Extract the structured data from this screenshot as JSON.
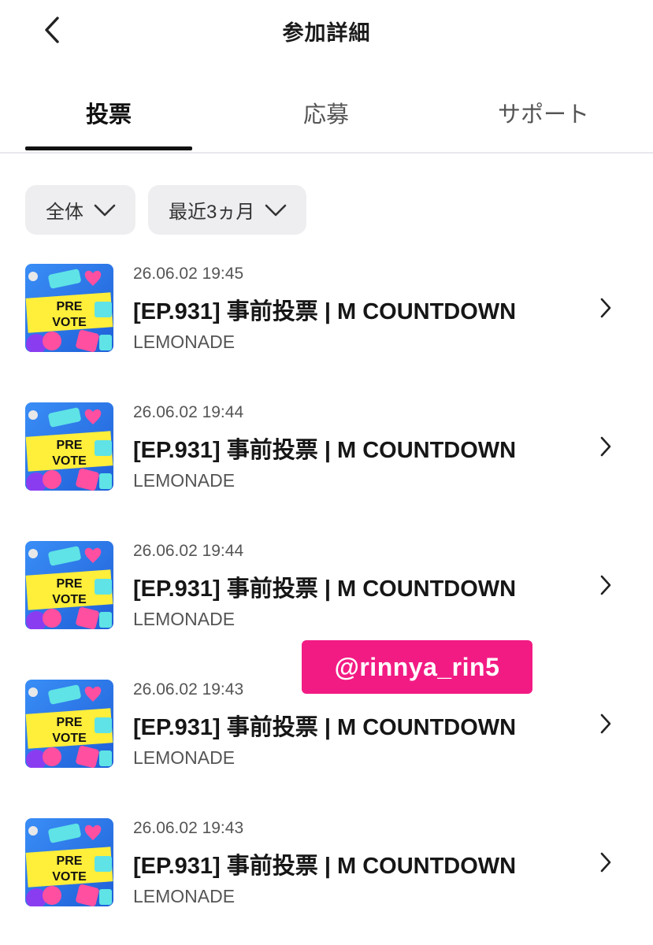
{
  "header": {
    "title": "参加詳細",
    "back_icon": "chevron-left-icon"
  },
  "tabs": [
    {
      "label": "投票",
      "active": true
    },
    {
      "label": "応募",
      "active": false
    },
    {
      "label": "サポート",
      "active": false
    }
  ],
  "filters": [
    {
      "label": "全体",
      "icon": "chevron-down-icon"
    },
    {
      "label": "最近3ヵ月",
      "icon": "chevron-down-icon"
    }
  ],
  "items": [
    {
      "date": "26.06.02 19:45",
      "title": "[EP.931] 事前投票 | M COUNTDOWN",
      "subtitle": "LEMONADE",
      "thumb_text_1": "PRE",
      "thumb_text_2": "VOTE"
    },
    {
      "date": "26.06.02 19:44",
      "title": "[EP.931] 事前投票 | M COUNTDOWN",
      "subtitle": "LEMONADE",
      "thumb_text_1": "PRE",
      "thumb_text_2": "VOTE"
    },
    {
      "date": "26.06.02 19:44",
      "title": "[EP.931] 事前投票 | M COUNTDOWN",
      "subtitle": "LEMONADE",
      "thumb_text_1": "PRE",
      "thumb_text_2": "VOTE"
    },
    {
      "date": "26.06.02 19:43",
      "title": "[EP.931] 事前投票 | M COUNTDOWN",
      "subtitle": "LEMONADE",
      "thumb_text_1": "PRE",
      "thumb_text_2": "VOTE"
    },
    {
      "date": "26.06.02 19:43",
      "title": "[EP.931] 事前投票 | M COUNTDOWN",
      "subtitle": "LEMONADE",
      "thumb_text_1": "PRE",
      "thumb_text_2": "VOTE"
    }
  ],
  "watermark": {
    "text": "@rinnya_rin5"
  },
  "colors": {
    "watermark_bg": "#f21b84",
    "thumb_bg": "#2f7df0",
    "thumb_banner": "#ffee3a",
    "thumb_pink": "#ff4fa0",
    "thumb_cyan": "#5fe3e6"
  }
}
